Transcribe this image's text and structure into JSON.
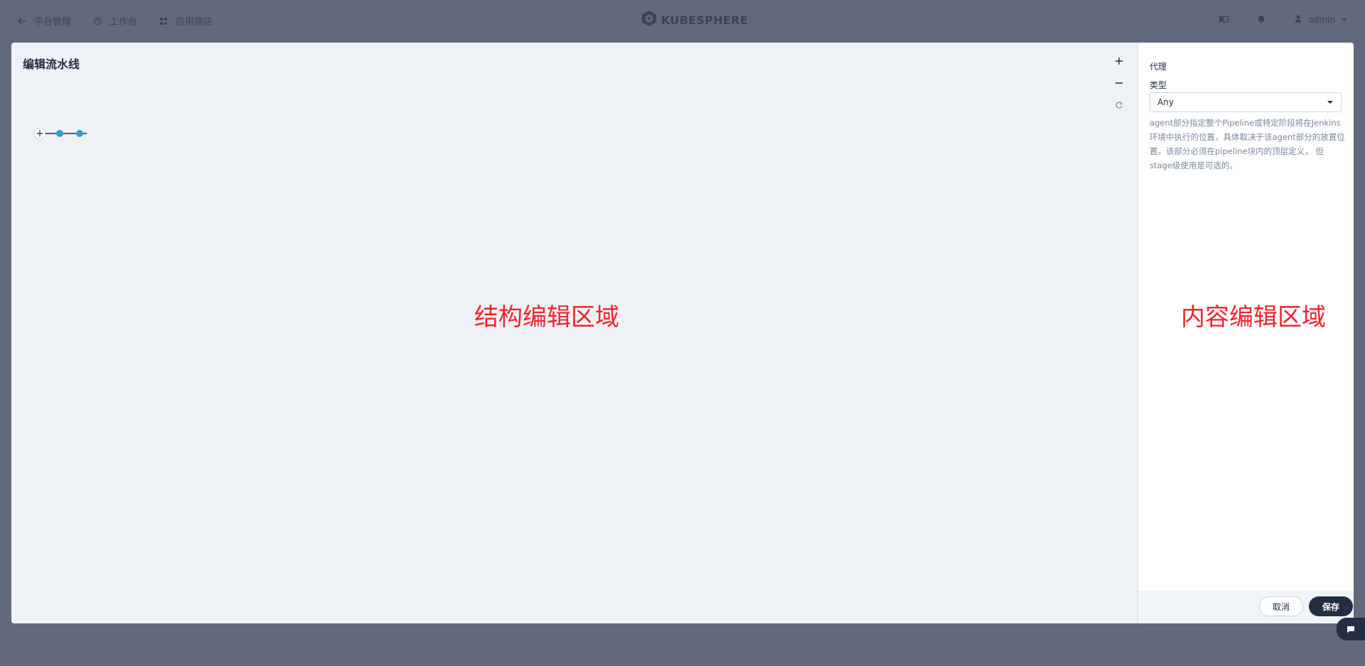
{
  "nav": {
    "items": [
      {
        "label": "平台管理",
        "icon": "arrow-left-icon"
      },
      {
        "label": "工作台",
        "icon": "dashboard-icon"
      },
      {
        "label": "应用商店",
        "icon": "appstore-icon"
      }
    ],
    "logo_text": "KUBESPHERE",
    "user": "admin"
  },
  "editor": {
    "title": "编辑流水线",
    "structure_area_label": "结构编辑区域"
  },
  "panel": {
    "heading": "代理",
    "type_label": "类型",
    "type_value": "Any",
    "description": "agent部分指定整个Pipeline或特定阶段将在Jenkins环境中执行的位置，具体取决于该agent部分的放置位置。该部分必须在pipeline块内的顶层定义， 但stage级使用是可选的。",
    "content_area_label": "内容编辑区域",
    "cancel_label": "取消",
    "save_label": "保存"
  },
  "colors": {
    "accent": "#329dce",
    "dark": "#242e42",
    "annotation": "#f5222d"
  }
}
